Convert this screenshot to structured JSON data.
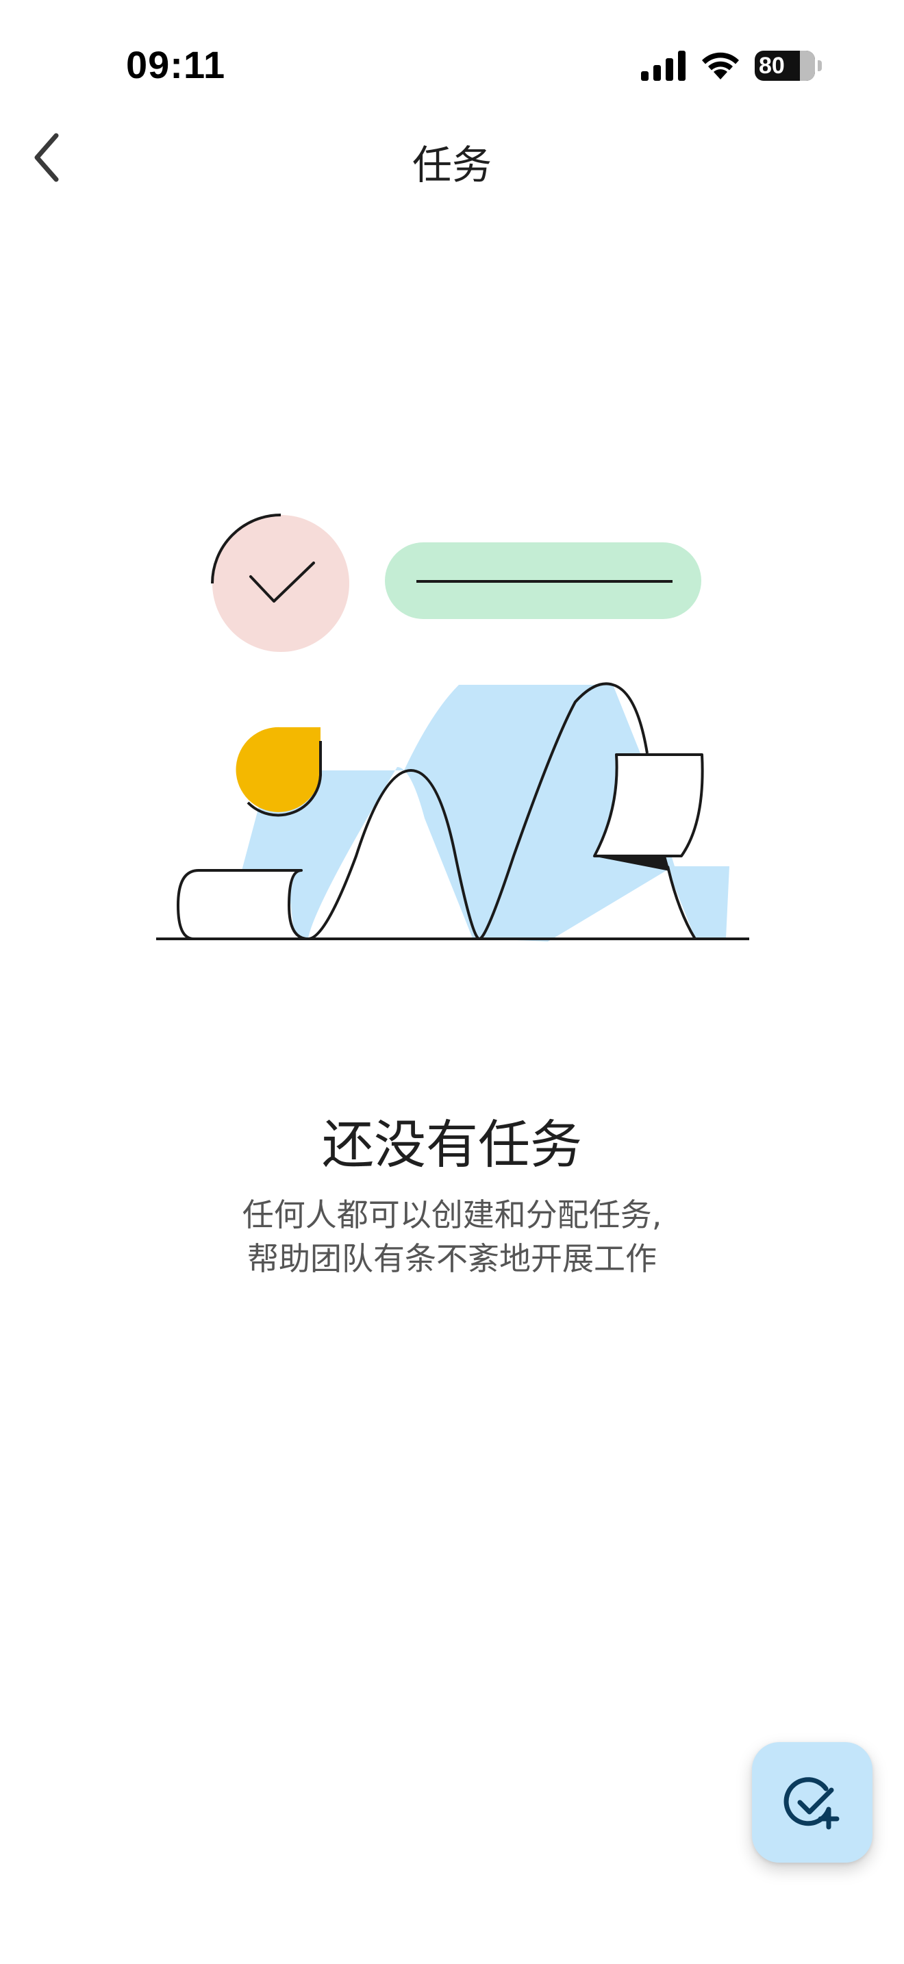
{
  "status_bar": {
    "time": "09:11",
    "battery_level": "80",
    "icons": [
      "cellular-signal-icon",
      "wifi-icon",
      "battery-charging-icon"
    ]
  },
  "nav": {
    "title": "任务",
    "back_icon": "chevron-left-icon"
  },
  "empty_state": {
    "title": "还没有任务",
    "description_line1": "任何人都可以创建和分配任务,",
    "description_line2": "帮助团队有条不紊地开展工作"
  },
  "fab": {
    "icon": "add-task-check-plus-icon",
    "icon_color": "#0b3b5c",
    "background": "#c3e5fa"
  },
  "colors": {
    "pink_circle": "#f6dcd9",
    "green_pill": "#c4edd4",
    "blue_paper": "#c3e5fa",
    "yellow_blob": "#f4b800"
  }
}
